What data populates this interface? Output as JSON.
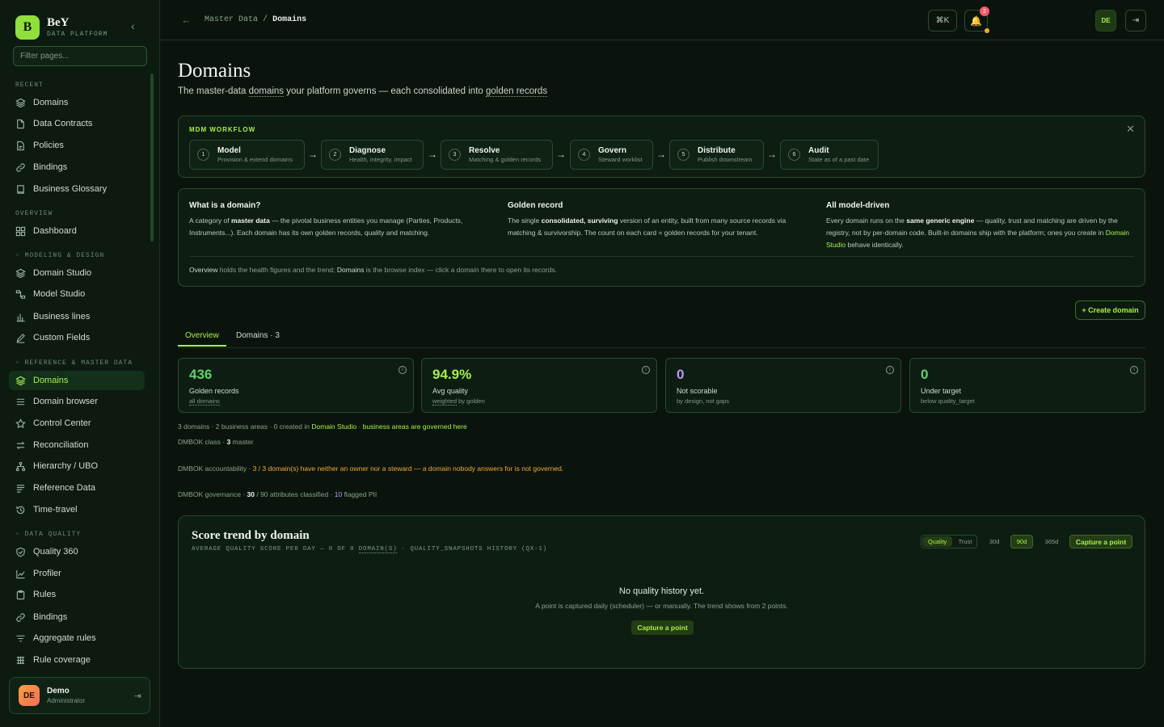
{
  "brand": {
    "logo_letter": "B",
    "name": "BeY",
    "subtitle": "DATA PLATFORM"
  },
  "sidebar": {
    "filter_placeholder": "Filter pages...",
    "sections": {
      "recent": "RECENT",
      "overview": "OVERVIEW",
      "modeling": "MODELING & DESIGN",
      "reference": "REFERENCE & MASTER DATA",
      "quality": "DATA QUALITY"
    },
    "recent": [
      "Domains",
      "Data Contracts",
      "Policies",
      "Bindings",
      "Business Glossary"
    ],
    "overview": [
      "Dashboard"
    ],
    "modeling": [
      "Domain Studio",
      "Model Studio",
      "Business lines",
      "Custom Fields"
    ],
    "reference": [
      "Domains",
      "Domain browser",
      "Control Center",
      "Reconciliation",
      "Hierarchy / UBO",
      "Reference Data",
      "Time-travel"
    ],
    "quality": [
      "Quality 360",
      "Profiler",
      "Rules",
      "Bindings",
      "Aggregate rules",
      "Rule coverage"
    ]
  },
  "user": {
    "initials": "DE",
    "name": "Demo",
    "role": "Administrator"
  },
  "topbar": {
    "breadcrumb_parent": "Master Data",
    "breadcrumb_sep": "/",
    "breadcrumb_current": "Domains",
    "shortcut": "⌘K",
    "notification_count": "2",
    "locale": "DE"
  },
  "page": {
    "title": "Domains",
    "subtitle_pre": "The master-data ",
    "subtitle_term1": "domains",
    "subtitle_mid": " your platform governs — each consolidated into ",
    "subtitle_term2": "golden records"
  },
  "workflow": {
    "title": "MDM WORKFLOW",
    "steps": [
      {
        "num": "1",
        "title": "Model",
        "sub": "Provision & extend domains"
      },
      {
        "num": "2",
        "title": "Diagnose",
        "sub": "Health, integrity, impact"
      },
      {
        "num": "3",
        "title": "Resolve",
        "sub": "Matching & golden records"
      },
      {
        "num": "4",
        "title": "Govern",
        "sub": "Steward worklist"
      },
      {
        "num": "5",
        "title": "Distribute",
        "sub": "Publish downstream"
      },
      {
        "num": "6",
        "title": "Audit",
        "sub": "State as of a past date"
      }
    ],
    "arrow": "→"
  },
  "explainer": {
    "c1_title": "What is a domain?",
    "c1_a": "A category of ",
    "c1_b": "master data",
    "c1_c": " — the pivotal business entities you manage (Parties, Products, Instruments...). Each domain has its own golden records, quality and matching.",
    "c2_title": "Golden record",
    "c2_a": "The single ",
    "c2_b": "consolidated, surviving",
    "c2_c": " version of an entity, built from many source records via matching & survivorship. The count on each card = golden records for your tenant.",
    "c3_title": "All model-driven",
    "c3_a": "Every domain runs on the ",
    "c3_b": "same generic engine",
    "c3_c": " — quality, trust and matching are driven by the registry, not by per-domain code. Built-in domains ship with the platform; ones you create in ",
    "c3_d": "Domain Studio",
    "c3_e": " behave identically.",
    "note_a": "Overview",
    "note_b": " holds the health figures and the trend; ",
    "note_c": "Domains",
    "note_d": " is the browse index — click a domain there to open its records."
  },
  "create_label": "+ Create domain",
  "tabs": [
    {
      "label": "Overview"
    },
    {
      "label": "Domains · 3"
    }
  ],
  "kpis": [
    {
      "value": "436",
      "label": "Golden records",
      "sub_a": "",
      "sub_u": "all domains",
      "sub_b": "",
      "color": "#5fd46a"
    },
    {
      "value": "94.9%",
      "label": "Avg quality",
      "sub_a": "",
      "sub_u": "weighted",
      "sub_b": " by golden",
      "color": "#a6f04a"
    },
    {
      "value": "0",
      "label": "Not scorable",
      "sub_a": "by design, not gaps",
      "sub_u": "",
      "sub_b": "",
      "color": "#b99af2"
    },
    {
      "value": "0",
      "label": "Under target",
      "sub_a": "below quality_target",
      "sub_u": "",
      "sub_b": "",
      "color": "#5fd46a"
    }
  ],
  "meta": {
    "l1_a": "3 domains · 2 business areas · 0 created in ",
    "l1_link": "Domain Studio",
    "l1_sep": " · ",
    "l1_link2": "business areas are governed here",
    "l2_a": "DMBOK class · ",
    "l2_b": "3",
    "l2_c": " master",
    "l3_a": "DMBOK accountability · ",
    "l3_warn": "3 / 3 domain(s) have neither an owner nor a steward — a domain nobody answers for is not governed.",
    "l4_a": "DMBOK governance · ",
    "l4_b": "30",
    "l4_c": " / 90 attributes classified · ",
    "l4_d": "10",
    "l4_e": " flagged PII"
  },
  "trend": {
    "title": "Score trend by domain",
    "sub_a": "AVERAGE QUALITY SCORE PER DAY — 0 OF 0 ",
    "sub_u": "DOMAIN(S)",
    "sub_b": " · QUALITY_SNAPSHOTS HISTORY (QX-1)",
    "seg_quality": "Quality",
    "seg_trust": "Trust",
    "r30": "30d",
    "r90": "90d",
    "r365": "365d",
    "capture": "Capture a point",
    "empty_title": "No quality history yet.",
    "empty_text": "A point is captured daily (scheduler) — or manually. The trend shows from 2 points.",
    "empty_capture": "Capture a point"
  }
}
